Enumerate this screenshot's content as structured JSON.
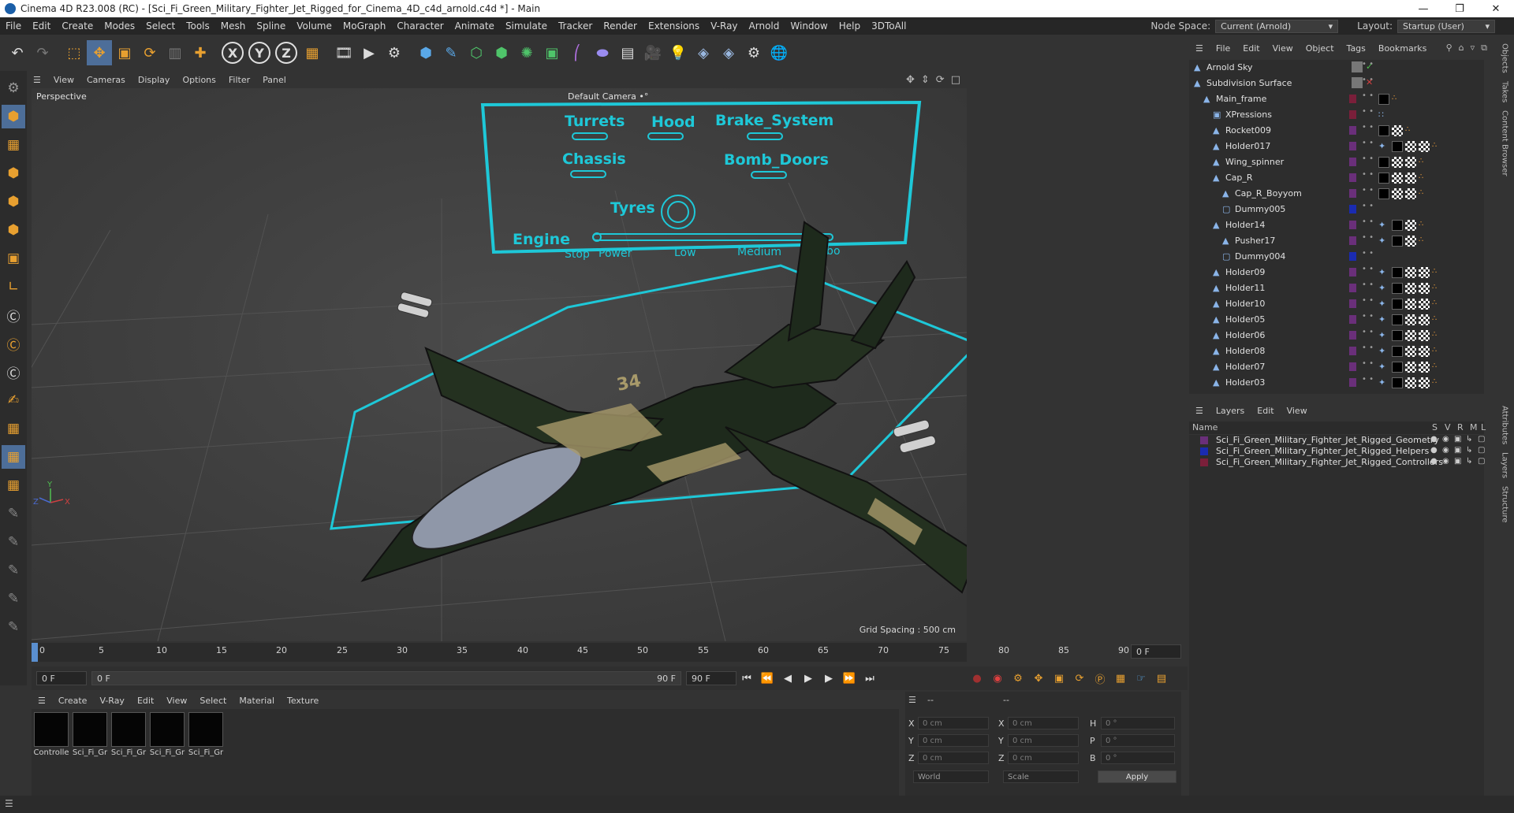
{
  "window": {
    "title": "Cinema 4D R23.008 (RC) - [Sci_Fi_Green_Military_Fighter_Jet_Rigged_for_Cinema_4D_c4d_arnold.c4d *] - Main",
    "controls": [
      "—",
      "❐",
      "✕"
    ]
  },
  "menubar": {
    "items": [
      "File",
      "Edit",
      "Create",
      "Modes",
      "Select",
      "Tools",
      "Mesh",
      "Spline",
      "Volume",
      "MoGraph",
      "Character",
      "Animate",
      "Simulate",
      "Tracker",
      "Render",
      "Extensions",
      "V-Ray",
      "Arnold",
      "Window",
      "Help",
      "3DToAll"
    ],
    "node_space_label": "Node Space:",
    "node_space_value": "Current (Arnold)",
    "layout_label": "Layout:",
    "layout_value": "Startup (User)"
  },
  "toolbar": {
    "xyz": [
      "X",
      "Y",
      "Z"
    ]
  },
  "viewport": {
    "menu": [
      "View",
      "Cameras",
      "Display",
      "Options",
      "Filter",
      "Panel"
    ],
    "view_name": "Perspective",
    "camera_name": "Default Camera •°",
    "grid_spacing": "Grid Spacing : 500 cm",
    "hud": {
      "turrets": "Turrets",
      "hood": "Hood",
      "brake": "Brake_System",
      "chassis": "Chassis",
      "bomb": "Bomb_Doors",
      "tyres": "Tyres",
      "engine": "Engine",
      "engine_ticks": [
        "Stop",
        "Power",
        "Low",
        "Medium",
        "Turbo"
      ]
    },
    "jet_number": "34",
    "axis": {
      "x": "X",
      "y": "Y",
      "z": "Z"
    }
  },
  "timeline": {
    "ticks": [
      "0",
      "5",
      "10",
      "15",
      "20",
      "25",
      "30",
      "35",
      "40",
      "45",
      "50",
      "55",
      "60",
      "65",
      "70",
      "75",
      "80",
      "85",
      "90"
    ],
    "current_frame": "0 F"
  },
  "playbar": {
    "start": "0 F",
    "range_start": "0 F",
    "range_end": "90 F",
    "end": "90 F"
  },
  "materials": {
    "menu": [
      "Create",
      "V-Ray",
      "Edit",
      "View",
      "Select",
      "Material",
      "Texture"
    ],
    "items": [
      "Controlle",
      "Sci_Fi_Gr",
      "Sci_Fi_Gr",
      "Sci_Fi_Gr",
      "Sci_Fi_Gr"
    ]
  },
  "coordinates": {
    "header_left": "--",
    "header_right": "--",
    "rows": [
      {
        "a": "X",
        "a_val": "0 cm",
        "b": "X",
        "b_val": "0 cm",
        "c": "H",
        "c_val": "0 °"
      },
      {
        "a": "Y",
        "a_val": "0 cm",
        "b": "Y",
        "b_val": "0 cm",
        "c": "P",
        "c_val": "0 °"
      },
      {
        "a": "Z",
        "a_val": "0 cm",
        "b": "Z",
        "b_val": "0 cm",
        "c": "B",
        "c_val": "0 °"
      }
    ],
    "world": "World",
    "scale": "Scale",
    "apply": "Apply"
  },
  "objects": {
    "menu": [
      "File",
      "Edit",
      "View",
      "Object",
      "Tags",
      "Bookmarks"
    ],
    "rows": [
      {
        "name": "Arnold Sky",
        "indent": 0,
        "color": "",
        "tags": "",
        "dot_color": "#4fbf4f"
      },
      {
        "name": "Subdivision Surface",
        "indent": 0,
        "color": "",
        "tags": "",
        "dot_color": "#d04040"
      },
      {
        "name": "Main_frame",
        "indent": 1,
        "color": "#7a1f3a",
        "tags": "bo"
      },
      {
        "name": "XPressions",
        "indent": 2,
        "color": "#7a1f3a",
        "tags": "x"
      },
      {
        "name": "Rocket009",
        "indent": 2,
        "color": "#6a2f7a",
        "tags": "bco"
      },
      {
        "name": "Holder017",
        "indent": 2,
        "color": "#6a2f7a",
        "tags": "ibcco"
      },
      {
        "name": "Wing_spinner",
        "indent": 2,
        "color": "#6a2f7a",
        "tags": "bcco"
      },
      {
        "name": "Cap_R",
        "indent": 2,
        "color": "#6a2f7a",
        "tags": "bcco"
      },
      {
        "name": "Cap_R_Boyyom",
        "indent": 3,
        "color": "#6a2f7a",
        "tags": "bcco"
      },
      {
        "name": "Dummy005",
        "indent": 3,
        "color": "#1a2bb0",
        "tags": ""
      },
      {
        "name": "Holder14",
        "indent": 2,
        "color": "#6a2f7a",
        "tags": "ibco"
      },
      {
        "name": "Pusher17",
        "indent": 3,
        "color": "#6a2f7a",
        "tags": "ibco"
      },
      {
        "name": "Dummy004",
        "indent": 3,
        "color": "#1a2bb0",
        "tags": ""
      },
      {
        "name": "Holder09",
        "indent": 2,
        "color": "#6a2f7a",
        "tags": "ibcco"
      },
      {
        "name": "Holder11",
        "indent": 2,
        "color": "#6a2f7a",
        "tags": "ibcco"
      },
      {
        "name": "Holder10",
        "indent": 2,
        "color": "#6a2f7a",
        "tags": "ibcco"
      },
      {
        "name": "Holder05",
        "indent": 2,
        "color": "#6a2f7a",
        "tags": "ibcco"
      },
      {
        "name": "Holder06",
        "indent": 2,
        "color": "#6a2f7a",
        "tags": "ibcco"
      },
      {
        "name": "Holder08",
        "indent": 2,
        "color": "#6a2f7a",
        "tags": "ibcco"
      },
      {
        "name": "Holder07",
        "indent": 2,
        "color": "#6a2f7a",
        "tags": "ibcco"
      },
      {
        "name": "Holder03",
        "indent": 2,
        "color": "#6a2f7a",
        "tags": "ibcco"
      }
    ]
  },
  "layers": {
    "menu": [
      "Layers",
      "Edit",
      "View"
    ],
    "headers": {
      "name": "Name",
      "s": "S",
      "v": "V",
      "r": "R",
      "m": "M",
      "l": "L"
    },
    "rows": [
      {
        "name": "Sci_Fi_Green_Military_Fighter_Jet_Rigged_Geometry",
        "color": "#6a2f7a"
      },
      {
        "name": "Sci_Fi_Green_Military_Fighter_Jet_Rigged_Helpers",
        "color": "#1a2bb0"
      },
      {
        "name": "Sci_Fi_Green_Military_Fighter_Jet_Rigged_Controllers",
        "color": "#7a1f3a"
      }
    ]
  },
  "side_tabs_top": [
    "Objects",
    "Takes",
    "Content Browser"
  ],
  "side_tabs_bottom": [
    "Attributes",
    "Layers",
    "Structure"
  ]
}
